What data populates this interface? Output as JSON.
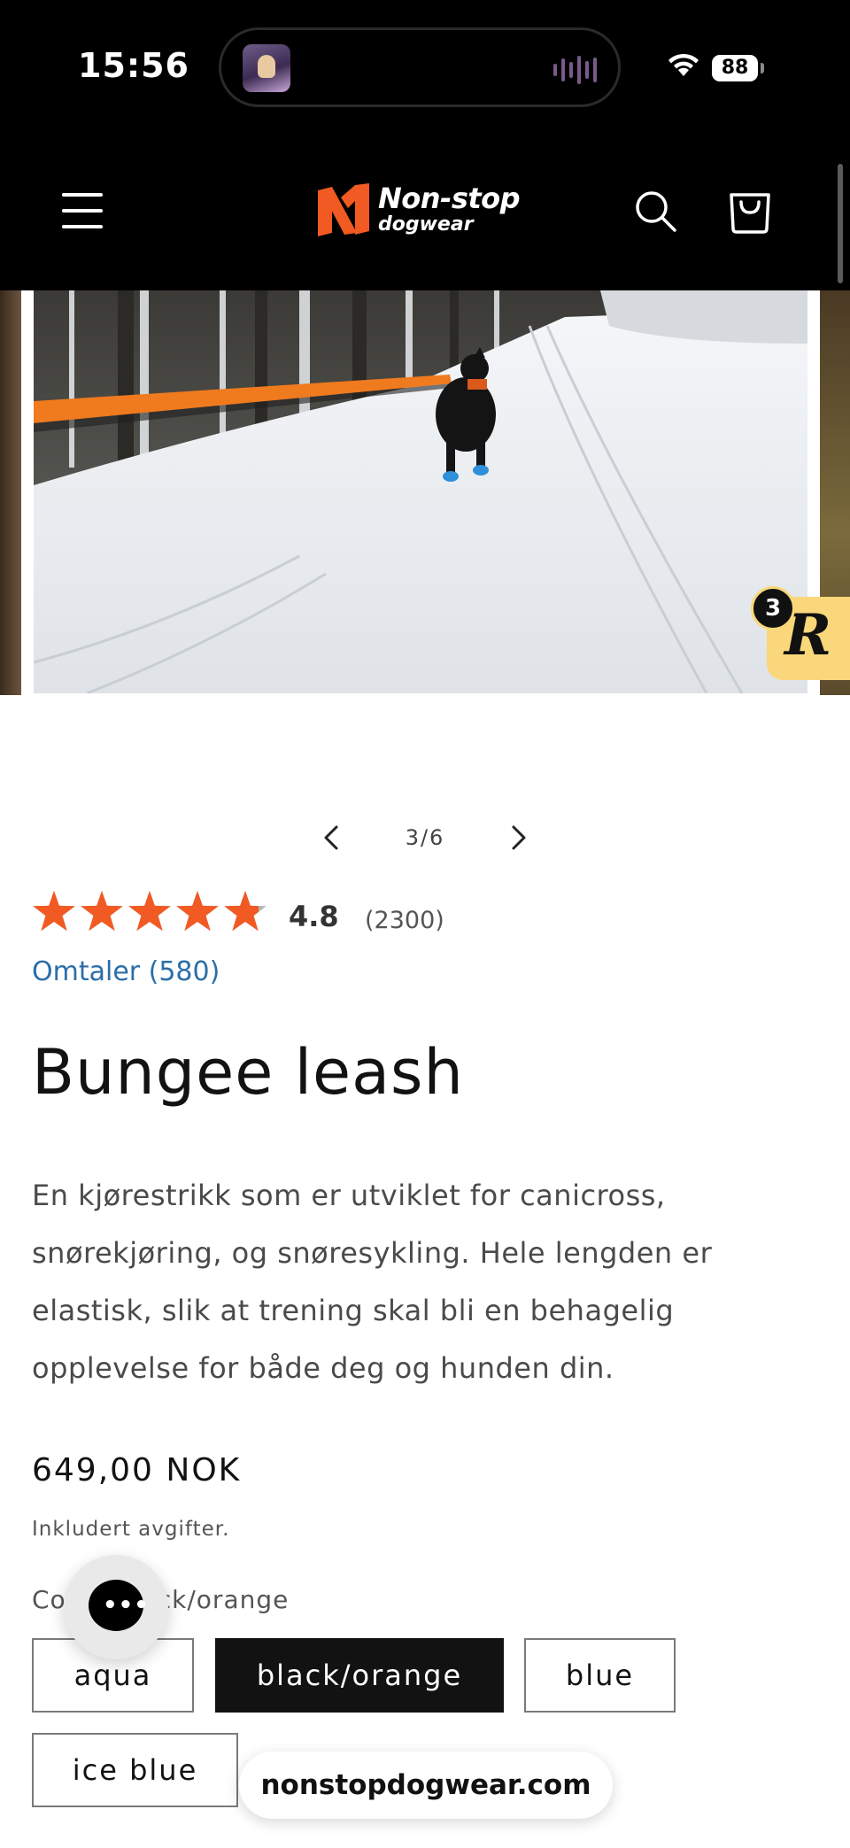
{
  "status_bar": {
    "time": "15:56",
    "battery": "88"
  },
  "header": {
    "logo_line1": "Non-stop",
    "logo_line2": "dogwear"
  },
  "gallery": {
    "current": "3/6"
  },
  "rating": {
    "value": "4.8",
    "count": "(2300)",
    "stars_fraction": 0.96,
    "reviews_link": "Omtaler (580)",
    "star_color": "#f15a22"
  },
  "reviews_badge": {
    "letter": "R",
    "count": "3"
  },
  "product": {
    "title": "Bungee leash",
    "description": "En kjørestrikk som er utviklet for canicross, snørekjøring, og snøresykling. Hele lengden er elastisk, slik at trening skal bli en behagelig opplevelse for både deg og hunden din.",
    "price": "649,00 NOK",
    "tax_note": "Inkludert avgifter.",
    "color_label": "Color:",
    "color_selected": "black/orange",
    "variants": [
      "aqua",
      "black/orange",
      "blue",
      "ice blue"
    ]
  },
  "chat": {
    "icon": "chat-bubble-icon"
  },
  "browser": {
    "url": "nonstopdogwear.com"
  },
  "colors": {
    "brand_orange": "#f15a22",
    "header_bg": "#000000",
    "link_blue": "#2b6ea8"
  }
}
